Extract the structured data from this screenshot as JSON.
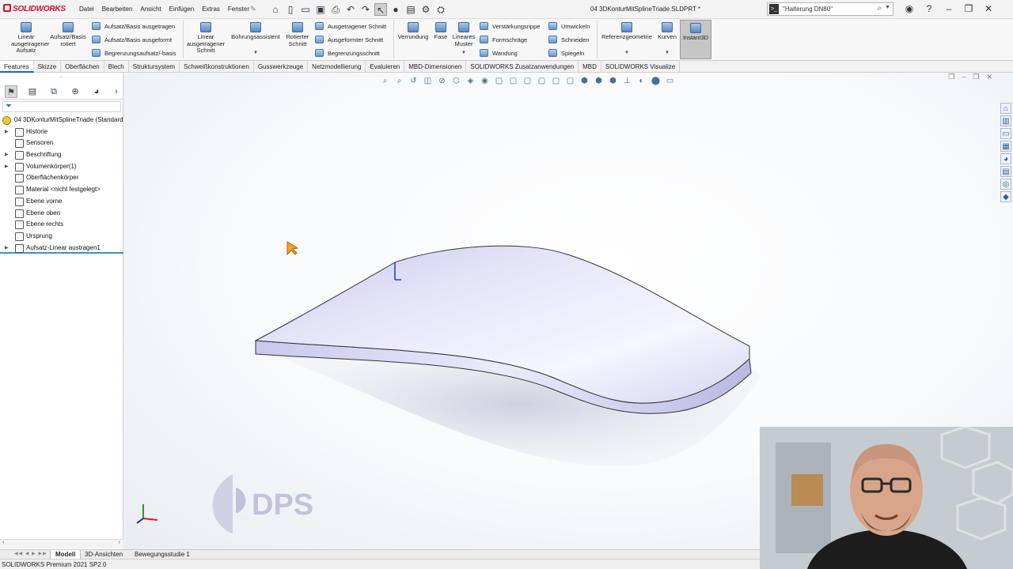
{
  "app": {
    "brand": "SOLIDWORKS",
    "document_title": "04 3DKonturMitSplineTriade.SLDPRT *"
  },
  "menu": [
    "Datei",
    "Bearbeiten",
    "Ansicht",
    "Einfügen",
    "Extras",
    "Fenster"
  ],
  "search": {
    "value": "\"Halterung DN80\""
  },
  "ribbon": {
    "linear_extruded_boss": "Linear ausgetragener Aufsatz",
    "revolved_boss": "Aufsatz/Basis rotiert",
    "swept_boss": "Aufsatz/Basis ausgetragen",
    "lofted_boss": "Aufsatz/Basis ausgeformt",
    "boundary_boss": "Begrenzungsaufsatz/-basis",
    "linear_extruded_cut": "Linear ausgetragener Schnitt",
    "hole_wizard": "Bohrungsassistent",
    "revolved_cut": "Rotierter Schnitt",
    "swept_cut": "Ausgetragener Schnitt",
    "lofted_cut": "Ausgeformter Schnitt",
    "boundary_cut": "Begrenzungsschnitt",
    "fillet": "Verrundung",
    "chamfer": "Fase",
    "linear_pattern": "Lineares Muster",
    "rib": "Verstärkungsrippe",
    "draft": "Formschräge",
    "shell": "Wandung",
    "wrap": "Umwickeln",
    "intersect": "Schneiden",
    "mirror": "Spiegeln",
    "reference_geometry": "Referenzgeometrie",
    "curves": "Kurven",
    "instant3d": "Instant3D"
  },
  "command_tabs": [
    "Features",
    "Skizze",
    "Oberflächen",
    "Blech",
    "Struktursystem",
    "Schweißkonstruktionen",
    "Gusswerkzeuge",
    "Netzmodellierung",
    "Evaluieren",
    "MBD-Dimensionen",
    "SOLIDWORKS Zusatzanwendungen",
    "MBD",
    "SOLIDWORKS Visualize"
  ],
  "feature_tree": {
    "root": "04 3DKonturMitSplineTriade  (Standard",
    "items": [
      "Historie",
      "Sensoren",
      "Beschriftung",
      "Volumenkörper(1)",
      "Oberflächenkörper",
      "Material <nicht festgelegt>",
      "Ebene vorne",
      "Ebene oben",
      "Ebene rechts",
      "Ursprung",
      "Aufsatz-Linear austragen1"
    ]
  },
  "watermark": "DPS",
  "bottom_tabs": [
    "Modell",
    "3D-Ansichten",
    "Bewegungsstudie 1"
  ],
  "status": "SOLIDWORKS Premium 2021 SP2.0",
  "colors": {
    "brand_red": "#c8102e",
    "part_face": "#dcdcf4",
    "accent_blue": "#1e66b8"
  }
}
